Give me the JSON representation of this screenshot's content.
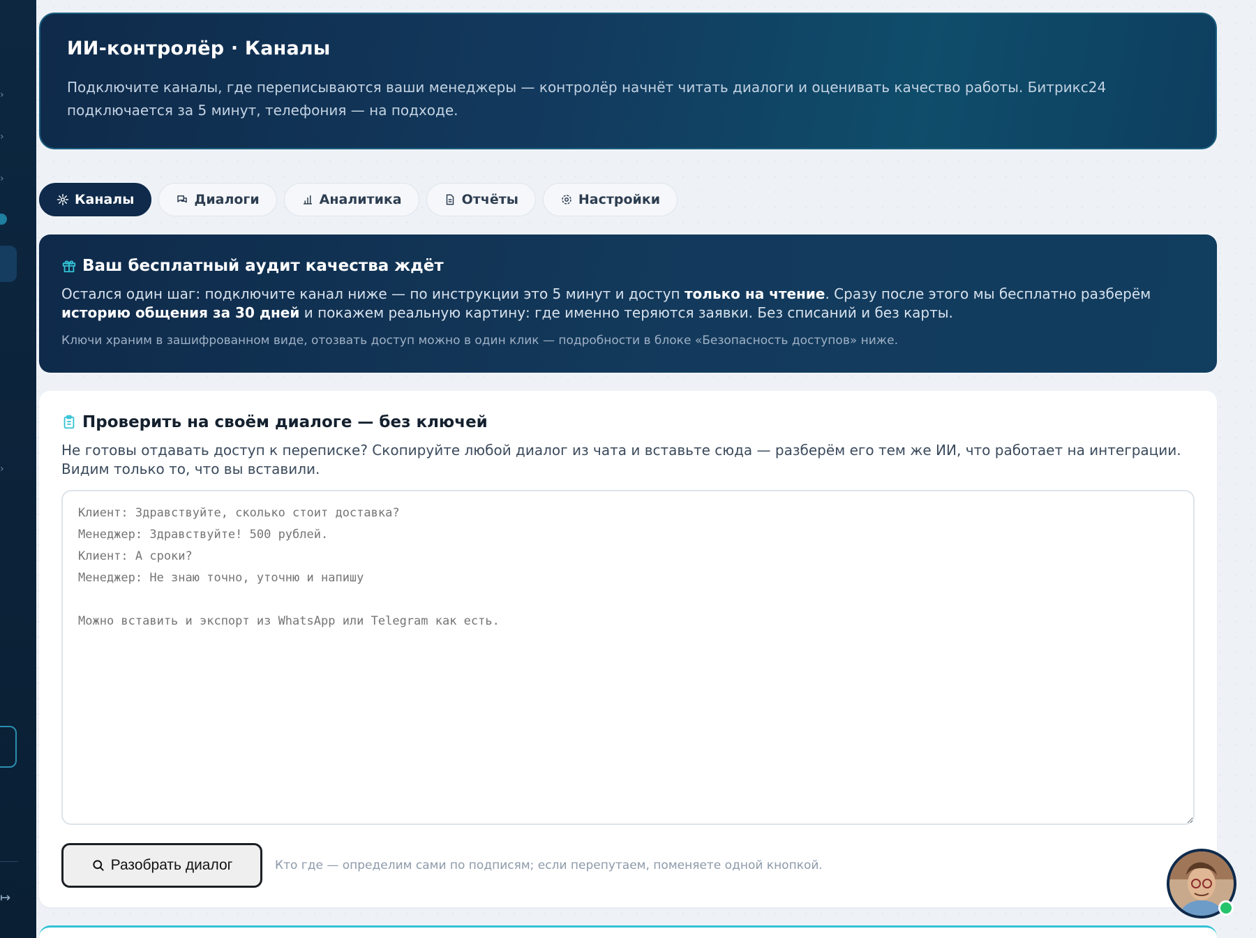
{
  "header": {
    "title": "ИИ-контролёр · Каналы",
    "description": "Подключите каналы, где переписываются ваши менеджеры — контролёр начнёт читать диалоги и оценивать качество работы. Битрикс24 подключается за 5 минут, телефония — на подходе."
  },
  "tabs": [
    {
      "label": "Каналы",
      "icon": "channels-icon",
      "active": true
    },
    {
      "label": "Диалоги",
      "icon": "chat-icon",
      "active": false
    },
    {
      "label": "Аналитика",
      "icon": "bar-chart-icon",
      "active": false
    },
    {
      "label": "Отчёты",
      "icon": "document-icon",
      "active": false
    },
    {
      "label": "Настройки",
      "icon": "gear-icon",
      "active": false
    }
  ],
  "audit": {
    "title": "Ваш бесплатный аудит качества ждёт",
    "text_1": "Остался один шаг: подключите канал ниже — по инструкции это 5 минут и доступ ",
    "text_bold_1": "только на чтение",
    "text_2": ". Сразу после этого мы бесплатно разберём ",
    "text_bold_2": "историю общения за 30 дней",
    "text_3": " и покажем реальную картину: где именно теряются заявки. Без списаний и без карты.",
    "note": "Ключи храним в зашифрованном виде, отозвать доступ можно в один клик — подробности в блоке «Безопасность доступов» ниже."
  },
  "check": {
    "title": "Проверить на своём диалоге — без ключей",
    "description": "Не готовы отдавать доступ к переписке? Скопируйте любой диалог из чата и вставьте сюда — разберём его тем же ИИ, что работает на интеграции. Видим только то, что вы вставили.",
    "placeholder": "Клиент: Здравствуйте, сколько стоит доставка?\nМенеджер: Здравствуйте! 500 рублей.\nКлиент: А сроки?\nМенеджер: Не знаю точно, уточню и напишу\n\nМожно вставить и экспорт из WhatsApp или Telegram как есть.",
    "value": "",
    "button_label": "Разобрать диалог",
    "hint": "Кто где — определим сами по подписям; если перепутаем, поменяете одной кнопкой."
  },
  "colors": {
    "accent_dark": "#0f2a4a",
    "accent_teal": "#33c2d6",
    "online": "#25c46a"
  }
}
